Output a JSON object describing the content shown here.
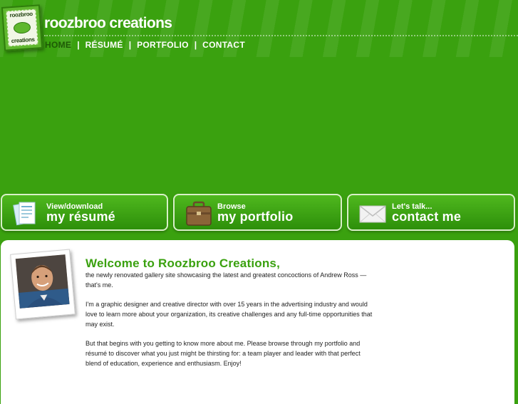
{
  "header": {
    "logo": {
      "line1": "roozbroo",
      "line2": "creations"
    },
    "site_title": "roozbroo creations",
    "nav": [
      {
        "label": "HOME",
        "active": true
      },
      {
        "label": "RÉSUMÉ",
        "active": false
      },
      {
        "label": "PORTFOLIO",
        "active": false
      },
      {
        "label": "CONTACT",
        "active": false
      }
    ],
    "separator": "|"
  },
  "cta": {
    "resume": {
      "sub": "View/download",
      "main": "my résumé",
      "icon": "documents-icon"
    },
    "portfolio": {
      "sub": "Browse",
      "main": "my portfolio",
      "icon": "briefcase-icon"
    },
    "contact": {
      "sub": "Let's talk...",
      "main": "contact me",
      "icon": "envelope-icon"
    }
  },
  "main": {
    "photo": "profile-photo",
    "welcome": "Welcome to Roozbroo Creations,",
    "paragraphs": [
      "the newly renovated gallery site showcasing the latest and greatest concoctions of Andrew Ross — that's me.",
      "I'm a graphic designer and creative director with over 15 years in the advertising industry and would love to learn more about your organization, its creative challenges and any full-time opportunities that may exist.",
      "But that begins with you getting to know more about me. Please browse through my portfolio and résumé to discover what you just might be thirsting for: a team player and leader with that perfect blend of education, experience and enthusiasm. Enjoy!"
    ]
  },
  "colors": {
    "background": "#3aa10f",
    "accent": "#3aa10f",
    "active_nav": "#1e5a06",
    "content_bg": "#ffffff"
  }
}
